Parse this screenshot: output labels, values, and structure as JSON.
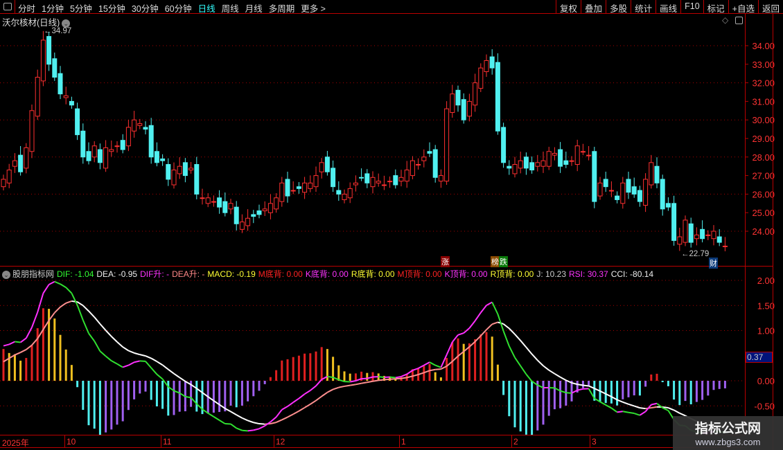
{
  "toolbar": {
    "periods": [
      "分时",
      "1分钟",
      "5分钟",
      "15分钟",
      "30分钟",
      "60分钟",
      "日线",
      "周线",
      "月线",
      "多周期",
      "更多 >"
    ],
    "active": "日线",
    "right_buttons": [
      "复权",
      "叠加",
      "多股",
      "统计",
      "画线",
      "F10",
      "标记",
      "+自选",
      "返回"
    ]
  },
  "main": {
    "title": "沃尔核材(日线)",
    "high_label": "34.97",
    "low_label": "22.79",
    "tag_zhang": "涨",
    "tag_bang": "榜",
    "tag_die": "跌",
    "tag_cai": "财"
  },
  "indicator": {
    "name": "股朋指标网",
    "items": [
      {
        "text": "DIF: -1.04",
        "color": "#3f3"
      },
      {
        "text": "DEA: -0.95",
        "color": "#eee"
      },
      {
        "text": "DIF升: -",
        "color": "#f3f"
      },
      {
        "text": "DEA升: -",
        "color": "#f88"
      },
      {
        "text": "MACD: -0.19",
        "color": "#ff3"
      },
      {
        "text": "M底背: 0.00",
        "color": "#f22"
      },
      {
        "text": "K底背: 0.00",
        "color": "#f3f"
      },
      {
        "text": "R底背: 0.00",
        "color": "#ff3"
      },
      {
        "text": "M顶背: 0.00",
        "color": "#f22"
      },
      {
        "text": "K顶背: 0.00",
        "color": "#f3f"
      },
      {
        "text": "R顶背: 0.00",
        "color": "#ff3"
      },
      {
        "text": "J: 10.23",
        "color": "#ccc"
      },
      {
        "text": "RSI: 30.37",
        "color": "#f3f"
      },
      {
        "text": "CCI: -80.14",
        "color": "#eee"
      }
    ],
    "current_value": "0.37"
  },
  "watermark": {
    "name": "指标公式网",
    "url": "www.zbgs3.com"
  },
  "chart_data": {
    "type": "candlestick",
    "price_ticks": [
      "34.00",
      "33.00",
      "32.00",
      "31.00",
      "30.00",
      "29.00",
      "28.00",
      "27.00",
      "26.00",
      "25.00",
      "24.00"
    ],
    "macd_ticks": [
      "2.00",
      "1.50",
      "1.00",
      "0.00",
      "-0.50"
    ],
    "date_labels": [
      "2025年",
      "10",
      "11",
      "12",
      "1",
      "2",
      "3"
    ],
    "close": [
      26.8,
      27.3,
      27.8,
      27.2,
      28.5,
      30.5,
      32.3,
      34.3,
      33.0,
      32.3,
      31.4,
      31.3,
      30.8,
      29.2,
      28.0,
      27.8,
      28.6,
      27.7,
      28.5,
      28.4,
      28.6,
      28.4,
      29.6,
      30.0,
      29.8,
      29.5,
      28.0,
      27.7,
      27.8,
      26.8,
      27.3,
      27.5,
      27.0,
      27.4,
      26.0,
      25.8,
      25.8,
      25.6,
      25.3,
      25.0,
      25.5,
      24.4,
      24.5,
      24.7,
      24.8,
      24.9,
      25.2,
      25.5,
      25.8,
      26.6,
      25.9,
      26.2,
      26.3,
      26.6,
      26.6,
      27.0,
      27.7,
      27.2,
      26.4,
      26.0,
      26.0,
      26.3,
      26.6,
      26.9,
      26.6,
      26.9,
      26.7,
      26.5,
      26.7,
      26.5,
      26.9,
      27.3,
      27.8,
      27.6,
      28.0,
      28.2,
      26.9,
      27.0,
      30.6,
      31.4,
      30.8,
      30.0,
      31.0,
      32.0,
      32.8,
      33.2,
      32.8,
      29.4,
      27.7,
      27.4,
      27.6,
      27.8,
      27.4,
      27.3,
      27.7,
      27.8,
      28.3,
      28.2,
      27.5,
      27.6,
      27.8,
      28.6,
      28.3,
      28.1,
      25.6,
      26.6,
      26.4,
      26.2,
      25.7,
      26.6,
      26.1,
      26.0,
      25.6,
      26.8,
      27.7,
      26.6,
      25.2,
      25.3,
      23.5,
      23.7,
      24.6,
      23.4,
      23.8,
      23.6,
      23.8,
      24.0,
      23.4,
      23.2
    ]
  }
}
